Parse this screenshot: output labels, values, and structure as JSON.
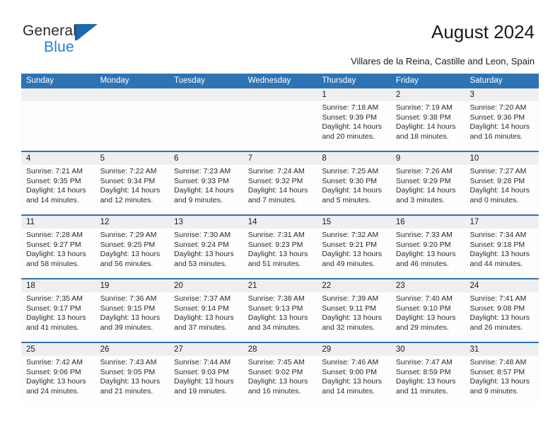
{
  "brand": {
    "name_top": "General",
    "name_bottom": "Blue",
    "mark_icon": "triangle-flag-icon",
    "accent_color": "#1c6bb0"
  },
  "header": {
    "title": "August 2024",
    "location": "Villares de la Reina, Castille and Leon, Spain"
  },
  "theme": {
    "header_blue": "#2e74b5",
    "date_band_gray": "#efefef",
    "cell_white": "#fdfdfd"
  },
  "calendar": {
    "weekdays": [
      "Sunday",
      "Monday",
      "Tuesday",
      "Wednesday",
      "Thursday",
      "Friday",
      "Saturday"
    ],
    "weeks": [
      [
        {
          "day": "",
          "lines": []
        },
        {
          "day": "",
          "lines": []
        },
        {
          "day": "",
          "lines": []
        },
        {
          "day": "",
          "lines": []
        },
        {
          "day": "1",
          "lines": [
            "Sunrise: 7:18 AM",
            "Sunset: 9:39 PM",
            "Daylight: 14 hours",
            "and 20 minutes."
          ]
        },
        {
          "day": "2",
          "lines": [
            "Sunrise: 7:19 AM",
            "Sunset: 9:38 PM",
            "Daylight: 14 hours",
            "and 18 minutes."
          ]
        },
        {
          "day": "3",
          "lines": [
            "Sunrise: 7:20 AM",
            "Sunset: 9:36 PM",
            "Daylight: 14 hours",
            "and 16 minutes."
          ]
        }
      ],
      [
        {
          "day": "4",
          "lines": [
            "Sunrise: 7:21 AM",
            "Sunset: 9:35 PM",
            "Daylight: 14 hours",
            "and 14 minutes."
          ]
        },
        {
          "day": "5",
          "lines": [
            "Sunrise: 7:22 AM",
            "Sunset: 9:34 PM",
            "Daylight: 14 hours",
            "and 12 minutes."
          ]
        },
        {
          "day": "6",
          "lines": [
            "Sunrise: 7:23 AM",
            "Sunset: 9:33 PM",
            "Daylight: 14 hours",
            "and 9 minutes."
          ]
        },
        {
          "day": "7",
          "lines": [
            "Sunrise: 7:24 AM",
            "Sunset: 9:32 PM",
            "Daylight: 14 hours",
            "and 7 minutes."
          ]
        },
        {
          "day": "8",
          "lines": [
            "Sunrise: 7:25 AM",
            "Sunset: 9:30 PM",
            "Daylight: 14 hours",
            "and 5 minutes."
          ]
        },
        {
          "day": "9",
          "lines": [
            "Sunrise: 7:26 AM",
            "Sunset: 9:29 PM",
            "Daylight: 14 hours",
            "and 3 minutes."
          ]
        },
        {
          "day": "10",
          "lines": [
            "Sunrise: 7:27 AM",
            "Sunset: 9:28 PM",
            "Daylight: 14 hours",
            "and 0 minutes."
          ]
        }
      ],
      [
        {
          "day": "11",
          "lines": [
            "Sunrise: 7:28 AM",
            "Sunset: 9:27 PM",
            "Daylight: 13 hours",
            "and 58 minutes."
          ]
        },
        {
          "day": "12",
          "lines": [
            "Sunrise: 7:29 AM",
            "Sunset: 9:25 PM",
            "Daylight: 13 hours",
            "and 56 minutes."
          ]
        },
        {
          "day": "13",
          "lines": [
            "Sunrise: 7:30 AM",
            "Sunset: 9:24 PM",
            "Daylight: 13 hours",
            "and 53 minutes."
          ]
        },
        {
          "day": "14",
          "lines": [
            "Sunrise: 7:31 AM",
            "Sunset: 9:23 PM",
            "Daylight: 13 hours",
            "and 51 minutes."
          ]
        },
        {
          "day": "15",
          "lines": [
            "Sunrise: 7:32 AM",
            "Sunset: 9:21 PM",
            "Daylight: 13 hours",
            "and 49 minutes."
          ]
        },
        {
          "day": "16",
          "lines": [
            "Sunrise: 7:33 AM",
            "Sunset: 9:20 PM",
            "Daylight: 13 hours",
            "and 46 minutes."
          ]
        },
        {
          "day": "17",
          "lines": [
            "Sunrise: 7:34 AM",
            "Sunset: 9:18 PM",
            "Daylight: 13 hours",
            "and 44 minutes."
          ]
        }
      ],
      [
        {
          "day": "18",
          "lines": [
            "Sunrise: 7:35 AM",
            "Sunset: 9:17 PM",
            "Daylight: 13 hours",
            "and 41 minutes."
          ]
        },
        {
          "day": "19",
          "lines": [
            "Sunrise: 7:36 AM",
            "Sunset: 9:15 PM",
            "Daylight: 13 hours",
            "and 39 minutes."
          ]
        },
        {
          "day": "20",
          "lines": [
            "Sunrise: 7:37 AM",
            "Sunset: 9:14 PM",
            "Daylight: 13 hours",
            "and 37 minutes."
          ]
        },
        {
          "day": "21",
          "lines": [
            "Sunrise: 7:38 AM",
            "Sunset: 9:13 PM",
            "Daylight: 13 hours",
            "and 34 minutes."
          ]
        },
        {
          "day": "22",
          "lines": [
            "Sunrise: 7:39 AM",
            "Sunset: 9:11 PM",
            "Daylight: 13 hours",
            "and 32 minutes."
          ]
        },
        {
          "day": "23",
          "lines": [
            "Sunrise: 7:40 AM",
            "Sunset: 9:10 PM",
            "Daylight: 13 hours",
            "and 29 minutes."
          ]
        },
        {
          "day": "24",
          "lines": [
            "Sunrise: 7:41 AM",
            "Sunset: 9:08 PM",
            "Daylight: 13 hours",
            "and 26 minutes."
          ]
        }
      ],
      [
        {
          "day": "25",
          "lines": [
            "Sunrise: 7:42 AM",
            "Sunset: 9:06 PM",
            "Daylight: 13 hours",
            "and 24 minutes."
          ]
        },
        {
          "day": "26",
          "lines": [
            "Sunrise: 7:43 AM",
            "Sunset: 9:05 PM",
            "Daylight: 13 hours",
            "and 21 minutes."
          ]
        },
        {
          "day": "27",
          "lines": [
            "Sunrise: 7:44 AM",
            "Sunset: 9:03 PM",
            "Daylight: 13 hours",
            "and 19 minutes."
          ]
        },
        {
          "day": "28",
          "lines": [
            "Sunrise: 7:45 AM",
            "Sunset: 9:02 PM",
            "Daylight: 13 hours",
            "and 16 minutes."
          ]
        },
        {
          "day": "29",
          "lines": [
            "Sunrise: 7:46 AM",
            "Sunset: 9:00 PM",
            "Daylight: 13 hours",
            "and 14 minutes."
          ]
        },
        {
          "day": "30",
          "lines": [
            "Sunrise: 7:47 AM",
            "Sunset: 8:59 PM",
            "Daylight: 13 hours",
            "and 11 minutes."
          ]
        },
        {
          "day": "31",
          "lines": [
            "Sunrise: 7:48 AM",
            "Sunset: 8:57 PM",
            "Daylight: 13 hours",
            "and 9 minutes."
          ]
        }
      ]
    ]
  }
}
